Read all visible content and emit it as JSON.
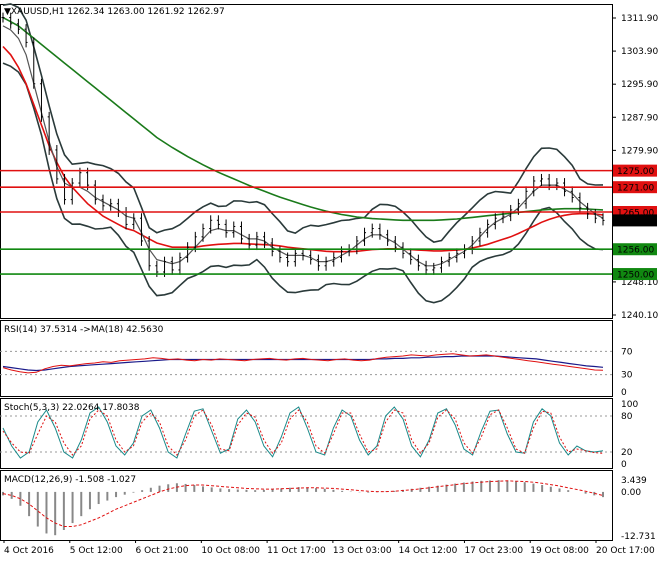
{
  "header": {
    "symbol_line": "▼XAUUSD,H1  1262.34 1263.00 1261.92 1262.97"
  },
  "colors": {
    "background": "#ffffff",
    "border": "#000000",
    "ma_fast": "#1a1a1a",
    "ma_mid": "#555555",
    "ma_red": "#e01010",
    "ma_green": "#1a7a1a",
    "level_red": "#e01010",
    "level_green": "#118811",
    "bollinger": "#2a3a3a",
    "rsi": "#e01010",
    "rsi_ma": "#1a1a8a",
    "stoch_main": "#1a8a8a",
    "stoch_signal": "#e01010",
    "macd_hist": "#888888",
    "macd_signal": "#e01010",
    "price_tag_bg": "#000000"
  },
  "chart_data": [
    {
      "type": "line",
      "panel": "price",
      "title": "XAUUSD,H1",
      "ohlc": {
        "open": 1262.34,
        "high": 1263.0,
        "low": 1261.92,
        "close": 1262.97
      },
      "ylim": [
        1240.1,
        1311.9
      ],
      "y_ticks": [
        "1311.90",
        "1303.90",
        "1295.90",
        "1287.90",
        "1279.90",
        "1248.10",
        "1240.10"
      ],
      "x_ticks": [
        "4 Oct 2016",
        "5 Oct 12:00",
        "6 Oct 21:00",
        "10 Oct 08:00",
        "11 Oct 17:00",
        "13 Oct 03:00",
        "14 Oct 12:00",
        "17 Oct 23:00",
        "19 Oct 08:00",
        "20 Oct 17:00"
      ],
      "levels": [
        {
          "label": "1275.00",
          "value": 1275.0,
          "color": "red"
        },
        {
          "label": "1271.00",
          "value": 1271.0,
          "color": "red"
        },
        {
          "label": "1265.00",
          "value": 1265.0,
          "color": "red"
        },
        {
          "label": "1256.00",
          "value": 1256.0,
          "color": "green"
        },
        {
          "label": "1250.00",
          "value": 1250.0,
          "color": "green"
        }
      ],
      "current_price_label": "1262.97",
      "price_series": [
        1312.0,
        1310.5,
        1309.2,
        1306.0,
        1296.0,
        1288.0,
        1280.0,
        1273.0,
        1268.0,
        1272.0,
        1274.5,
        1271.5,
        1268.0,
        1266.5,
        1267.0,
        1265.0,
        1262.0,
        1263.5,
        1258.0,
        1252.0,
        1250.5,
        1253.0,
        1251.0,
        1254.0,
        1256.5,
        1259.0,
        1261.0,
        1263.0,
        1262.0,
        1260.0,
        1261.5,
        1258.5,
        1257.0,
        1259.0,
        1257.5,
        1255.5,
        1254.0,
        1253.0,
        1255.0,
        1254.5,
        1253.5,
        1252.0,
        1253.0,
        1254.0,
        1255.5,
        1256.0,
        1258.0,
        1260.0,
        1261.0,
        1259.5,
        1258.0,
        1256.5,
        1255.0,
        1253.5,
        1252.0,
        1251.0,
        1251.5,
        1253.0,
        1254.0,
        1255.0,
        1256.0,
        1258.0,
        1260.0,
        1262.0,
        1263.5,
        1264.0,
        1265.5,
        1267.0,
        1270.0,
        1272.5,
        1273.0,
        1271.5,
        1272.0,
        1270.0,
        1268.5,
        1266.0,
        1264.5,
        1263.5,
        1262.97
      ],
      "ma_fast": [
        1310,
        1309,
        1307,
        1303,
        1296,
        1289,
        1282,
        1276,
        1272,
        1271,
        1271,
        1270,
        1268.5,
        1267.5,
        1266.5,
        1265.5,
        1264,
        1263.5,
        1260,
        1256,
        1253.5,
        1253,
        1252.5,
        1253,
        1254.5,
        1256.5,
        1258.5,
        1260.5,
        1261,
        1260.5,
        1260.5,
        1259.5,
        1258.5,
        1258.5,
        1258,
        1256.5,
        1255.5,
        1254.5,
        1254.5,
        1254.5,
        1254,
        1253,
        1253,
        1253.5,
        1254.5,
        1255.5,
        1257,
        1258.5,
        1259.5,
        1259.5,
        1258.5,
        1257.5,
        1256,
        1254.5,
        1253,
        1252,
        1252,
        1252.5,
        1253.5,
        1254.5,
        1255.5,
        1257,
        1259,
        1261,
        1262.5,
        1263.5,
        1264.5,
        1266,
        1268,
        1270,
        1271.5,
        1271.5,
        1271.5,
        1270.5,
        1269.5,
        1267.5,
        1266,
        1264.5,
        1263.5
      ],
      "ma_slow_red": [
        1305,
        1303,
        1300,
        1296,
        1291,
        1286,
        1281,
        1277,
        1273.5,
        1271,
        1269,
        1267,
        1265.5,
        1264,
        1263,
        1262,
        1261,
        1260.5,
        1259.5,
        1258.5,
        1257.5,
        1257,
        1256.5,
        1256.5,
        1256.5,
        1256.5,
        1256.8,
        1257,
        1257.2,
        1257.3,
        1257.4,
        1257.4,
        1257.3,
        1257.2,
        1257.1,
        1257,
        1256.8,
        1256.5,
        1256.3,
        1256.1,
        1255.9,
        1255.7,
        1255.5,
        1255.4,
        1255.4,
        1255.4,
        1255.5,
        1255.7,
        1255.9,
        1256,
        1256.1,
        1256.1,
        1256,
        1255.9,
        1255.8,
        1255.7,
        1255.6,
        1255.6,
        1255.7,
        1255.8,
        1256,
        1256.3,
        1256.7,
        1257.2,
        1257.8,
        1258.4,
        1259,
        1259.8,
        1260.7,
        1261.6,
        1262.5,
        1263.2,
        1263.8,
        1264.2,
        1264.5,
        1264.6,
        1264.6,
        1264.5,
        1264.3
      ],
      "ma_slow_green": [
        1312,
        1311,
        1310,
        1308.5,
        1307,
        1305.5,
        1304,
        1302.5,
        1301,
        1299.5,
        1298,
        1296.5,
        1295,
        1293.5,
        1292,
        1290.5,
        1289,
        1287.5,
        1286,
        1284.5,
        1283,
        1281.8,
        1280.6,
        1279.5,
        1278.4,
        1277.4,
        1276.4,
        1275.5,
        1274.6,
        1273.8,
        1273,
        1272.2,
        1271.4,
        1270.7,
        1270,
        1269.3,
        1268.6,
        1268,
        1267.4,
        1266.8,
        1266.2,
        1265.7,
        1265.2,
        1264.8,
        1264.4,
        1264.1,
        1263.8,
        1263.6,
        1263.4,
        1263.3,
        1263.2,
        1263.1,
        1263,
        1263,
        1263,
        1263,
        1263,
        1263.1,
        1263.2,
        1263.3,
        1263.5,
        1263.7,
        1263.9,
        1264.1,
        1264.3,
        1264.5,
        1264.7,
        1264.9,
        1265.1,
        1265.3,
        1265.5,
        1265.6,
        1265.7,
        1265.8,
        1265.8,
        1265.8,
        1265.7,
        1265.6,
        1265.5
      ]
    },
    {
      "type": "line",
      "panel": "rsi",
      "title": "RSI(14) 37.5314  ->MA(18) 42.5630",
      "ylim": [
        0,
        100
      ],
      "y_ticks": [
        "70",
        "30",
        "0"
      ],
      "series": [
        {
          "name": "RSI(14)",
          "values": [
            42,
            38,
            35,
            33,
            34,
            40,
            44,
            46,
            45,
            47,
            49,
            50,
            52,
            51,
            54,
            55,
            56,
            57,
            59,
            58,
            56,
            57,
            55,
            54,
            56,
            55,
            57,
            56,
            55,
            54,
            56,
            57,
            58,
            56,
            55,
            57,
            58,
            56,
            55,
            54,
            56,
            57,
            55,
            54,
            55,
            58,
            60,
            61,
            62,
            64,
            63,
            62,
            64,
            65,
            66,
            64,
            62,
            63,
            64,
            62,
            60,
            58,
            56,
            54,
            52,
            50,
            48,
            46,
            44,
            42,
            40,
            38,
            37.53
          ]
        },
        {
          "name": "MA(18)",
          "values": [
            44,
            42,
            40,
            38,
            37,
            38,
            40,
            42,
            44,
            45,
            46,
            47,
            48,
            49,
            50,
            51,
            52,
            53,
            54,
            55,
            56,
            56,
            56,
            56,
            56,
            56,
            56,
            56,
            56,
            56,
            56,
            56,
            56,
            56,
            56,
            56,
            56,
            56,
            56,
            56,
            56,
            56,
            56,
            56,
            56,
            57,
            57,
            58,
            58,
            59,
            59,
            60,
            60,
            61,
            61,
            62,
            62,
            62,
            62,
            62,
            61,
            60,
            59,
            58,
            57,
            55,
            53,
            51,
            49,
            47,
            45,
            44,
            42.56
          ]
        }
      ]
    },
    {
      "type": "line",
      "panel": "stochastic",
      "title": "Stoch(5,3,3) 22.0264 17.8038",
      "ylim": [
        0,
        100
      ],
      "y_ticks": [
        "100",
        "80",
        "20",
        "0"
      ],
      "series": [
        {
          "name": "%K",
          "values": [
            60,
            30,
            10,
            20,
            70,
            90,
            60,
            20,
            10,
            40,
            85,
            95,
            70,
            30,
            15,
            35,
            80,
            90,
            60,
            20,
            10,
            50,
            88,
            92,
            55,
            18,
            25,
            75,
            90,
            70,
            30,
            12,
            45,
            85,
            95,
            60,
            20,
            15,
            60,
            90,
            80,
            40,
            15,
            30,
            80,
            95,
            75,
            30,
            12,
            40,
            85,
            92,
            65,
            25,
            15,
            55,
            88,
            90,
            50,
            20,
            18,
            70,
            92,
            80,
            35,
            15,
            30,
            22,
            20,
            22.03
          ]
        },
        {
          "name": "%D",
          "values": [
            55,
            35,
            20,
            18,
            50,
            80,
            70,
            35,
            15,
            30,
            75,
            90,
            80,
            40,
            20,
            30,
            70,
            85,
            70,
            30,
            15,
            40,
            80,
            90,
            65,
            25,
            22,
            65,
            85,
            78,
            40,
            18,
            35,
            75,
            90,
            70,
            30,
            18,
            50,
            85,
            85,
            50,
            20,
            25,
            70,
            90,
            85,
            40,
            18,
            35,
            78,
            90,
            75,
            35,
            18,
            45,
            82,
            90,
            60,
            25,
            18,
            60,
            88,
            85,
            45,
            20,
            25,
            22,
            19,
            17.8
          ]
        }
      ]
    },
    {
      "type": "bar",
      "panel": "macd",
      "title": "MACD(12,26,9) -1.508 -1.027",
      "ylim": [
        -12.731,
        3.439
      ],
      "y_ticks": [
        "3.439",
        "0.00",
        "-12.731"
      ],
      "series": [
        {
          "name": "histogram",
          "values": [
            -1,
            -2,
            -4,
            -7,
            -10,
            -12,
            -12.5,
            -11,
            -9,
            -7,
            -5,
            -3.5,
            -2.5,
            -1.5,
            -0.8,
            -0.2,
            0.5,
            1.2,
            1.8,
            2.2,
            2.5,
            2.3,
            2,
            1.6,
            1.3,
            1,
            0.8,
            0.7,
            0.6,
            0.5,
            0.6,
            0.8,
            1,
            1.2,
            1.4,
            1.3,
            1.1,
            0.9,
            0.6,
            0.3,
            0.1,
            -0.1,
            -0.2,
            -0.1,
            0.1,
            0.3,
            0.6,
            0.9,
            1.2,
            1.5,
            1.8,
            2.1,
            2.4,
            2.7,
            3,
            3.2,
            3.3,
            3.4,
            3.3,
            3.1,
            2.8,
            2.4,
            2,
            1.5,
            1,
            0.5,
            0,
            -0.5,
            -1,
            -1.508
          ]
        },
        {
          "name": "signal",
          "values": [
            -0.5,
            -1,
            -2,
            -3.5,
            -5.5,
            -7.5,
            -9,
            -10,
            -10,
            -9.5,
            -8.5,
            -7.5,
            -6.3,
            -5,
            -4,
            -3,
            -2,
            -1,
            0,
            0.8,
            1.4,
            1.8,
            2,
            2,
            1.8,
            1.6,
            1.4,
            1.2,
            1,
            0.9,
            0.8,
            0.8,
            0.9,
            1,
            1.1,
            1.2,
            1.2,
            1.1,
            1,
            0.8,
            0.6,
            0.4,
            0.2,
            0.1,
            0.1,
            0.2,
            0.4,
            0.6,
            0.9,
            1.2,
            1.5,
            1.8,
            2.1,
            2.4,
            2.6,
            2.8,
            3,
            3.1,
            3.2,
            3.1,
            3,
            2.8,
            2.5,
            2.1,
            1.7,
            1.2,
            0.7,
            0.2,
            -0.4,
            -1.027
          ]
        }
      ]
    }
  ]
}
